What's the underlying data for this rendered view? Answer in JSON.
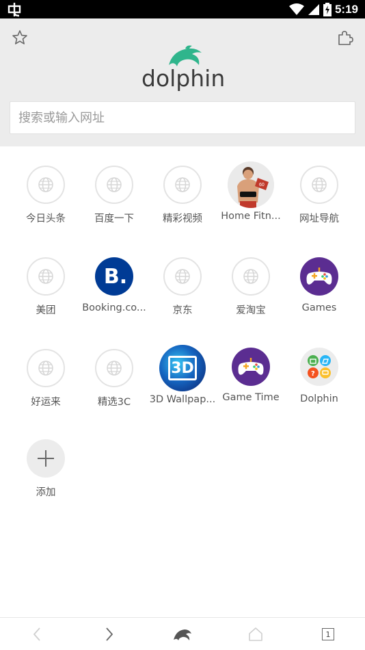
{
  "status_bar": {
    "time": "5:19"
  },
  "header": {
    "logo_text": "dolphin",
    "search_placeholder": "搜索或输入网址"
  },
  "colors": {
    "logo_green": "#2fb58c",
    "header_bg": "#ececec",
    "booking_blue": "#003b95",
    "games_purple": "#5b2d91"
  },
  "speed_dial": [
    {
      "label": "今日头条",
      "icon": "globe-icon"
    },
    {
      "label": "百度一下",
      "icon": "globe-icon"
    },
    {
      "label": "精彩视频",
      "icon": "globe-icon"
    },
    {
      "label": "Home Fitn...",
      "icon": "fitness-app-icon"
    },
    {
      "label": "网址导航",
      "icon": "globe-icon"
    },
    {
      "label": "美团",
      "icon": "globe-icon"
    },
    {
      "label": "Booking.co...",
      "icon": "booking-icon"
    },
    {
      "label": "京东",
      "icon": "globe-icon"
    },
    {
      "label": "爱淘宝",
      "icon": "globe-icon"
    },
    {
      "label": "Games",
      "icon": "gamepad-icon"
    },
    {
      "label": "好运来",
      "icon": "globe-icon"
    },
    {
      "label": "精选3C",
      "icon": "globe-icon"
    },
    {
      "label": "3D Wallpap...",
      "icon": "3d-wallpaper-icon"
    },
    {
      "label": "Game Time",
      "icon": "gamepad-icon"
    },
    {
      "label": "Dolphin",
      "icon": "dolphin-apps-icon"
    },
    {
      "label": "添加",
      "icon": "plus-icon"
    }
  ],
  "booking_letter": "B.",
  "wallpaper_text": "3D",
  "bottom_bar": {
    "tab_count": "1"
  }
}
